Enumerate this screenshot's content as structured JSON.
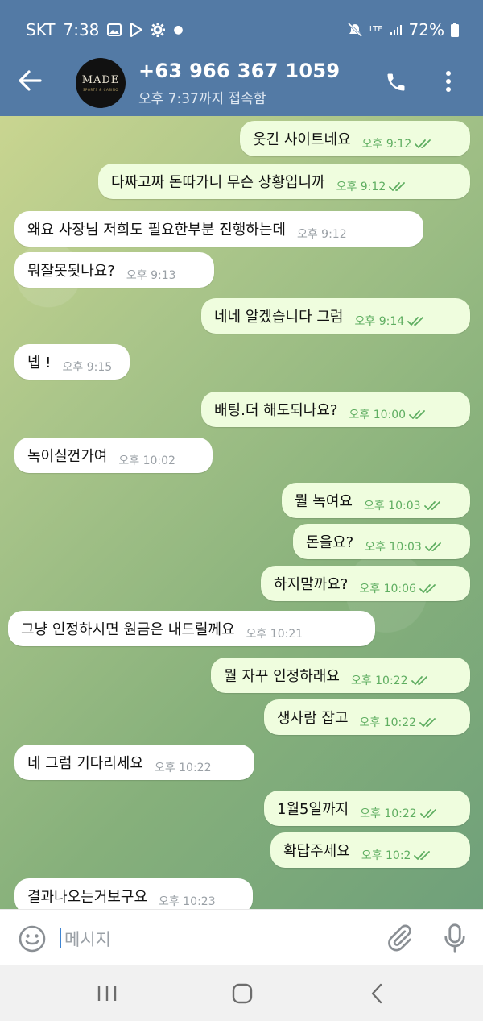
{
  "status_bar": {
    "carrier": "SKT",
    "time": "7:38",
    "network": "LTE",
    "battery": "72%"
  },
  "header": {
    "avatar_logo_main": "MADE",
    "avatar_logo_sub": "SPORTS & CASINO",
    "title": "+63 966 367 1059",
    "subtitle": "오후 7:37까지 접속함"
  },
  "messages": [
    {
      "text": "웃긴 사이트네요",
      "time": "오후 9:12",
      "dir": "out"
    },
    {
      "text": "다짜고짜 돈따가니 무슨 상황입니까",
      "time": "오후 9:12",
      "dir": "out"
    },
    {
      "text": "왜요 사장님 저희도 필요한부분 진행하는데",
      "time": "오후 9:12",
      "dir": "in"
    },
    {
      "text": "뭐잘못됫나요?",
      "time": "오후 9:13",
      "dir": "in"
    },
    {
      "text": "네네 알겠습니다 그럼",
      "time": "오후 9:14",
      "dir": "out"
    },
    {
      "text": "넵 !",
      "time": "오후 9:15",
      "dir": "in"
    },
    {
      "text": "배팅.더 해도되나요?",
      "time": "오후 10:00",
      "dir": "out"
    },
    {
      "text": "녹이실껀가여",
      "time": "오후 10:02",
      "dir": "in"
    },
    {
      "text": "뭘 녹여요",
      "time": "오후 10:03",
      "dir": "out"
    },
    {
      "text": "돈을요?",
      "time": "오후 10:03",
      "dir": "out"
    },
    {
      "text": "하지말까요?",
      "time": "오후 10:06",
      "dir": "out"
    },
    {
      "text": "그냥 인정하시면 원금은 내드릴께요",
      "time": "오후 10:21",
      "dir": "in"
    },
    {
      "text": "뭘 자꾸 인정하래요",
      "time": "오후 10:22",
      "dir": "out"
    },
    {
      "text": "생사람 잡고",
      "time": "오후 10:22",
      "dir": "out"
    },
    {
      "text": "네 그럼 기다리세요",
      "time": "오후 10:22",
      "dir": "in"
    },
    {
      "text": "1월5일까지",
      "time": "오후 10:22",
      "dir": "out"
    },
    {
      "text": "확답주세요",
      "time": "오후 10:2",
      "dir": "out"
    },
    {
      "text": "결과나오는거보구요",
      "time": "오후 10:23",
      "dir": "in"
    }
  ],
  "composer": {
    "placeholder": "메시지"
  },
  "colors": {
    "header": "#537aa5",
    "outgoing_bubble": "#effdde",
    "incoming_bubble": "#ffffff",
    "check_green": "#5fae61"
  }
}
